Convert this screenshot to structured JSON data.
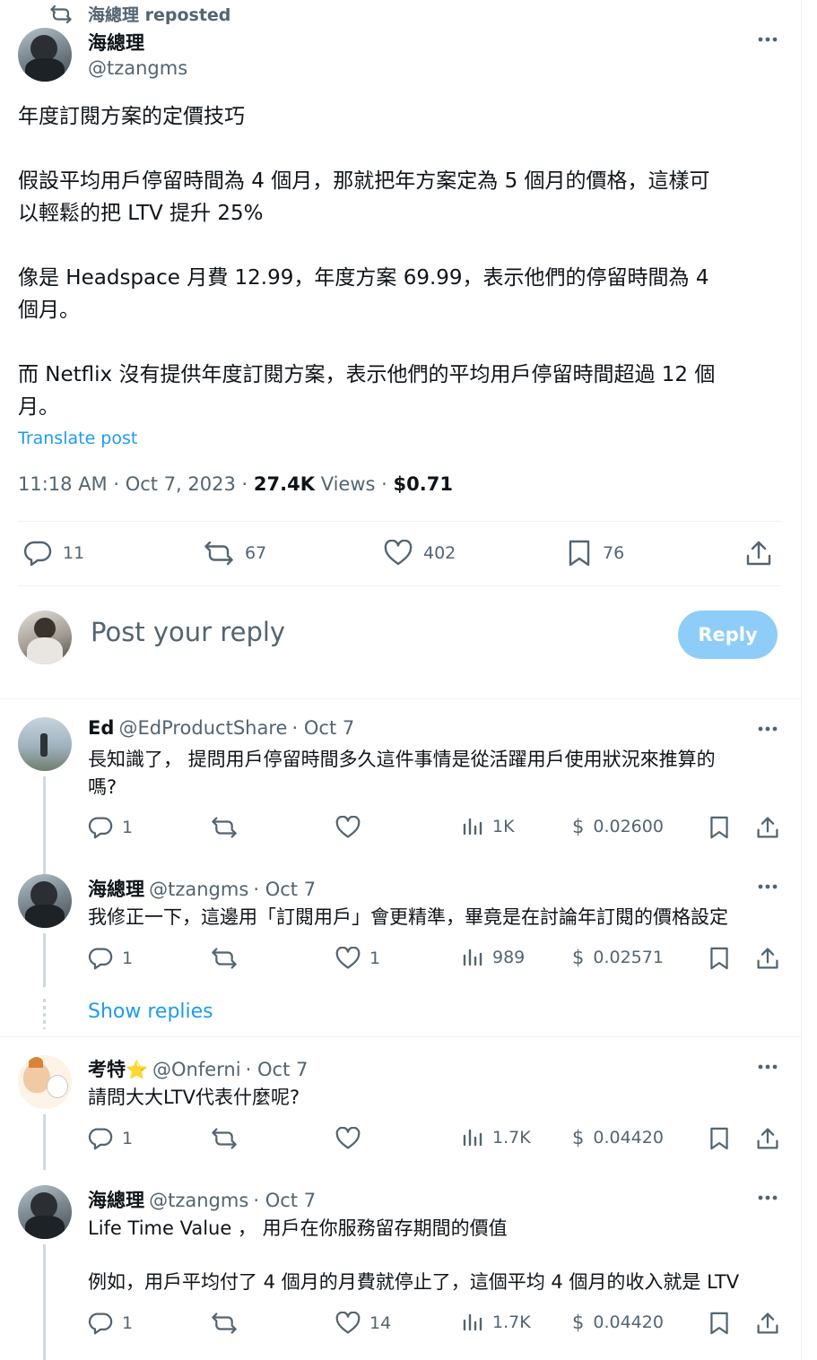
{
  "repost_banner": {
    "label": "海總理 reposted"
  },
  "main_post": {
    "author_name": "海總理",
    "author_handle": "@tzangms",
    "paragraphs": [
      "年度訂閱方案的定價技巧",
      "假設平均用戶停留時間為 4 個月，那就把年方案定為 5 個月的價格，這樣可",
      "以輕鬆的把 LTV 提升 25%",
      "像是 Headspace 月費 12.99，年度方案 69.99，表示他們的停留時間為 4",
      "個月。",
      "而 Netflix 沒有提供年度訂閱方案，表示他們的平均用戶停留時間超過 12 個",
      "月。"
    ],
    "translate_label": "Translate post",
    "timestamp": "11:18 AM · Oct 7, 2023",
    "separator": "·",
    "views_count": "27.4K",
    "views_label": "Views",
    "earnings": "$0.71",
    "stats": {
      "replies": "11",
      "reposts": "67",
      "likes": "402",
      "bookmarks": "76"
    }
  },
  "composer": {
    "placeholder": "Post your reply",
    "button_label": "Reply"
  },
  "show_replies_label": "Show replies",
  "replies": [
    {
      "name": "Ed",
      "handle": "@EdProductShare",
      "date": "· Oct 7",
      "lines": [
        "長知識了， 提問用戶停留時間多久這件事情是從活躍用戶使用狀況來推算的",
        "嗎?"
      ],
      "replies": "1",
      "reposts": "",
      "likes": "",
      "views": "1K",
      "tip": "0.02600"
    },
    {
      "name": "海總理",
      "handle": "@tzangms",
      "date": "· Oct 7",
      "lines": [
        "我修正一下，這邊用「訂閱用戶」會更精準，畢竟是在討論年訂閱的價格設定"
      ],
      "replies": "1",
      "reposts": "",
      "likes": "1",
      "views": "989",
      "tip": "0.02571"
    },
    {
      "name": "考特",
      "badge": "⭐",
      "handle": "@Onferni",
      "date": "· Oct 7",
      "lines": [
        "請問大大LTV代表什麼呢?"
      ],
      "replies": "1",
      "reposts": "",
      "likes": "",
      "views": "1.7K",
      "tip": "0.04420"
    },
    {
      "name": "海總理",
      "handle": "@tzangms",
      "date": "· Oct 7",
      "lines": [
        "Life Time Value ， 用戶在你服務留存期間的價值",
        "例如，用戶平均付了 4 個月的月費就停止了，這個平均 4 個月的收入就是 LTV"
      ],
      "replies": "1",
      "reposts": "",
      "likes": "14",
      "views": "1.7K",
      "tip": "0.04420"
    }
  ],
  "tip_currency": "$",
  "colors": {
    "link": "#1d9bf0",
    "reply_button": "#8ecdf8",
    "muted": "#536471",
    "text": "#0f1419"
  }
}
